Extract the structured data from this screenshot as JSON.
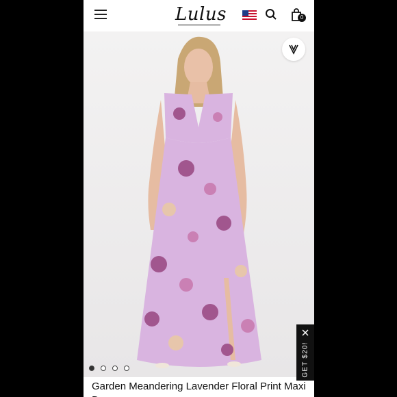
{
  "header": {
    "logo_text": "Lulus",
    "cart_count": "0",
    "icons": [
      "menu-icon",
      "us-flag-icon",
      "search-icon",
      "shopping-bag-icon"
    ]
  },
  "product": {
    "title": "Garden Meandering Lavender Floral Print Maxi D",
    "image_count": 4,
    "active_image": 1,
    "dress_color": "#d9b4e0",
    "flower_colors": [
      "#9c4c86",
      "#c97bb0",
      "#e9c9a6"
    ]
  },
  "promo": {
    "label": "GET $20!",
    "close_icon": "close-icon"
  },
  "favorite": {
    "icon": "heart-v-icon"
  }
}
